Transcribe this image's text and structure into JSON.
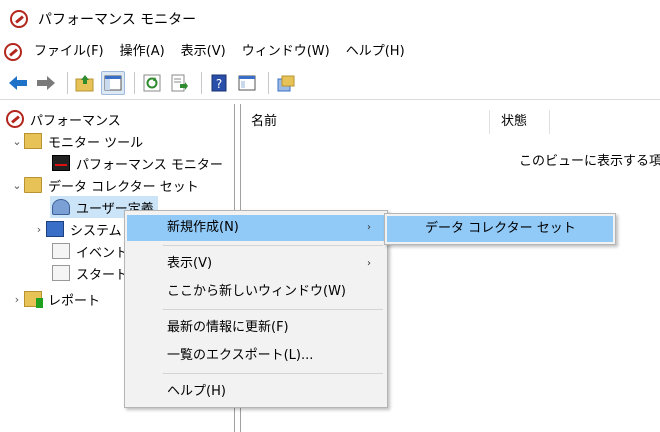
{
  "window": {
    "title": "パフォーマンス モニター"
  },
  "menubar": {
    "items": [
      {
        "label": "ファイル(F)"
      },
      {
        "label": "操作(A)"
      },
      {
        "label": "表示(V)"
      },
      {
        "label": "ウィンドウ(W)"
      },
      {
        "label": "ヘルプ(H)"
      }
    ]
  },
  "toolbar": {
    "icons": [
      "back-arrow-icon",
      "forward-arrow-icon",
      "up-folder-icon",
      "show-hide-tree-icon",
      "refresh-icon",
      "export-list-icon",
      "help-icon",
      "properties-icon",
      "new-window-icon"
    ],
    "colors": {
      "back": "#1e73c8",
      "forward": "#7a7a7a",
      "help": "#2a4fa8"
    }
  },
  "tree": {
    "root": "パフォーマンス",
    "monitoring_tools": "モニター ツール",
    "performance_monitor": "パフォーマンス モニター",
    "data_collector_sets": "データ コレクター セット",
    "user_defined": "ユーザー定義",
    "system": "システム",
    "event_trace": "イベント",
    "startup": "スタート",
    "reports": "レポート"
  },
  "list": {
    "col_name": "名前",
    "col_status": "状態",
    "empty_message": "このビューに表示する項目"
  },
  "context_menu": {
    "new": "新規作成(N)",
    "view": "表示(V)",
    "new_window": "ここから新しいウィンドウ(W)",
    "refresh": "最新の情報に更新(F)",
    "export": "一覧のエクスポート(L)...",
    "help": "ヘルプ(H)"
  },
  "submenu": {
    "data_collector_set": "データ コレクター セット"
  },
  "colors": {
    "highlight": "#91c9f7",
    "tree_selected": "#cce4f7",
    "menu_bg": "#f2f2f2"
  }
}
